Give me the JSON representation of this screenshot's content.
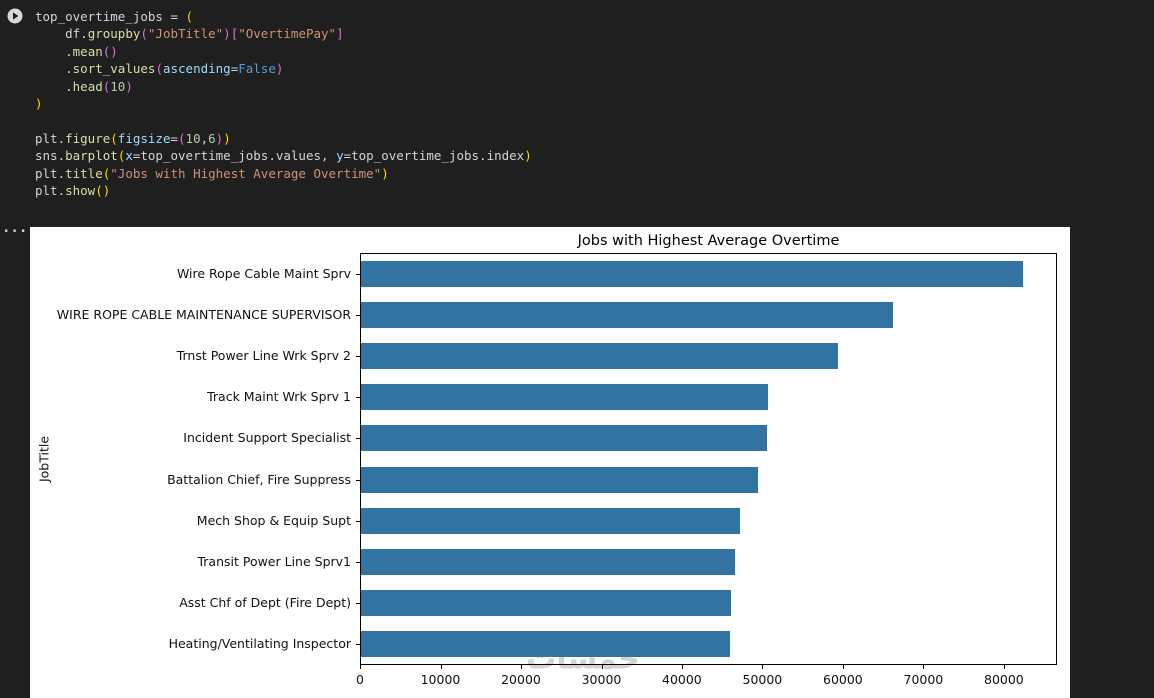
{
  "colors": {
    "background": "#1f1f1f",
    "figure_background": "#ffffff"
  },
  "code": {
    "lines": [
      [
        {
          "c": "plain",
          "t": "top_overtime_jobs = "
        },
        {
          "c": "b1",
          "t": "("
        }
      ],
      [
        {
          "c": "plain",
          "t": "    df."
        },
        {
          "c": "func",
          "t": "groupby"
        },
        {
          "c": "b2",
          "t": "("
        },
        {
          "c": "str",
          "t": "\"JobTitle\""
        },
        {
          "c": "b2",
          "t": ")"
        },
        {
          "c": "b2",
          "t": "["
        },
        {
          "c": "str",
          "t": "\"OvertimePay\""
        },
        {
          "c": "b2",
          "t": "]"
        }
      ],
      [
        {
          "c": "plain",
          "t": "    ."
        },
        {
          "c": "func",
          "t": "mean"
        },
        {
          "c": "b2",
          "t": "()"
        }
      ],
      [
        {
          "c": "plain",
          "t": "    ."
        },
        {
          "c": "func",
          "t": "sort_values"
        },
        {
          "c": "b2",
          "t": "("
        },
        {
          "c": "arg",
          "t": "ascending"
        },
        {
          "c": "plain",
          "t": "="
        },
        {
          "c": "kw",
          "t": "False"
        },
        {
          "c": "b2",
          "t": ")"
        }
      ],
      [
        {
          "c": "plain",
          "t": "    ."
        },
        {
          "c": "func",
          "t": "head"
        },
        {
          "c": "b2",
          "t": "("
        },
        {
          "c": "num",
          "t": "10"
        },
        {
          "c": "b2",
          "t": ")"
        }
      ],
      [
        {
          "c": "b1",
          "t": ")"
        }
      ],
      [],
      [
        {
          "c": "plain",
          "t": "plt."
        },
        {
          "c": "func",
          "t": "figure"
        },
        {
          "c": "b1",
          "t": "("
        },
        {
          "c": "arg",
          "t": "figsize"
        },
        {
          "c": "plain",
          "t": "="
        },
        {
          "c": "b2",
          "t": "("
        },
        {
          "c": "num",
          "t": "10"
        },
        {
          "c": "plain",
          "t": ","
        },
        {
          "c": "num",
          "t": "6"
        },
        {
          "c": "b2",
          "t": ")"
        },
        {
          "c": "b1",
          "t": ")"
        }
      ],
      [
        {
          "c": "plain",
          "t": "sns."
        },
        {
          "c": "func",
          "t": "barplot"
        },
        {
          "c": "b1",
          "t": "("
        },
        {
          "c": "arg",
          "t": "x"
        },
        {
          "c": "plain",
          "t": "=top_overtime_jobs.values, "
        },
        {
          "c": "arg",
          "t": "y"
        },
        {
          "c": "plain",
          "t": "=top_overtime_jobs.index"
        },
        {
          "c": "b1",
          "t": ")"
        }
      ],
      [
        {
          "c": "plain",
          "t": "plt."
        },
        {
          "c": "func",
          "t": "title"
        },
        {
          "c": "b1",
          "t": "("
        },
        {
          "c": "str",
          "t": "\"Jobs with Highest Average Overtime\""
        },
        {
          "c": "b1",
          "t": ")"
        }
      ],
      [
        {
          "c": "plain",
          "t": "plt."
        },
        {
          "c": "func",
          "t": "show"
        },
        {
          "c": "b1",
          "t": "()"
        }
      ]
    ]
  },
  "output": {
    "ellipsis": "...",
    "watermark": "خمسات"
  },
  "chart_data": {
    "type": "bar",
    "orientation": "horizontal",
    "title": "Jobs with Highest Average Overtime",
    "xlabel": "",
    "ylabel": "JobTitle",
    "categories": [
      "Wire Rope Cable Maint Sprv",
      "WIRE ROPE CABLE MAINTENANCE SUPERVISOR",
      "Trnst Power Line Wrk Sprv 2",
      "Track Maint Wrk Sprv 1",
      "Incident Support Specialist",
      "Battalion Chief, Fire Suppress",
      "Mech Shop & Equip Supt",
      "Transit Power Line Sprv1",
      "Asst Chf of Dept (Fire Dept)",
      "Heating/Ventilating Inspector"
    ],
    "values": [
      82300,
      66100,
      59200,
      50600,
      50400,
      49300,
      47100,
      46400,
      46000,
      45900
    ],
    "xlim": [
      0,
      86600
    ],
    "xticks": [
      0,
      10000,
      20000,
      30000,
      40000,
      50000,
      60000,
      70000,
      80000
    ],
    "bar_color": "#3274a1",
    "grid": false,
    "legend": false
  }
}
